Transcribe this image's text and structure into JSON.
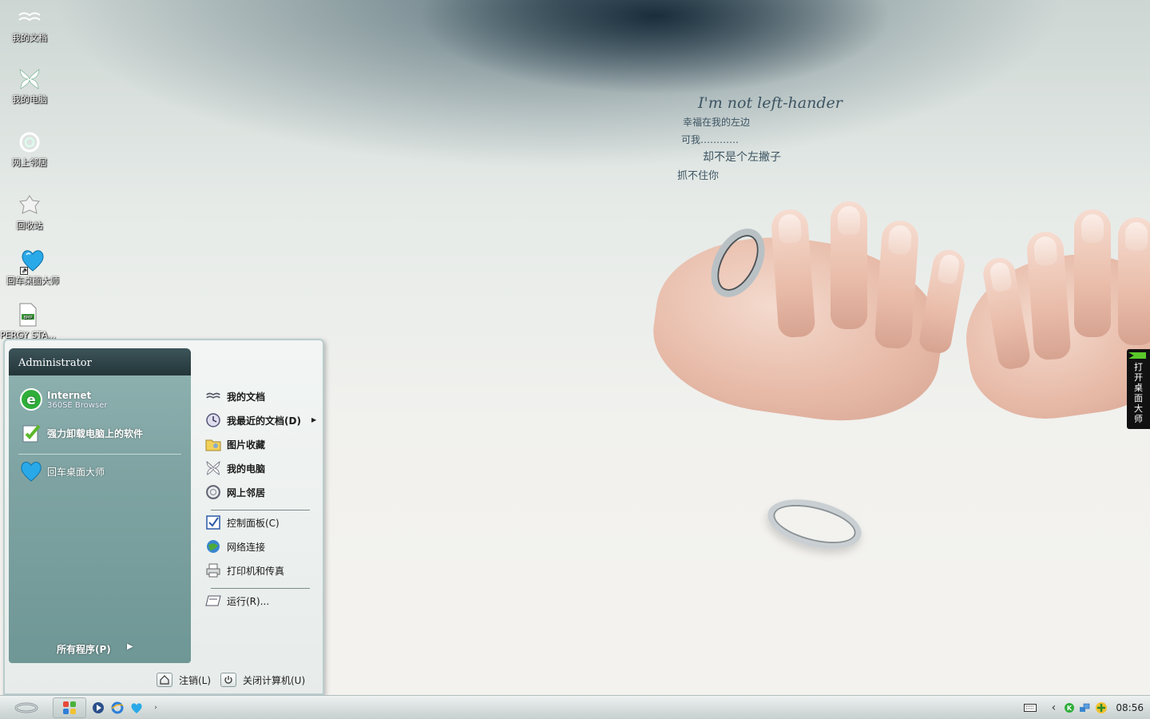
{
  "desktop": {
    "icons": [
      {
        "label": "我的文档",
        "icon": "my-documents-icon"
      },
      {
        "label": "我的电脑",
        "icon": "my-computer-icon"
      },
      {
        "label": "网上邻居",
        "icon": "network-places-icon"
      },
      {
        "label": "回收站",
        "icon": "recycle-bin-icon"
      },
      {
        "label": "回车桌面大师",
        "icon": "heart-shortcut-icon"
      },
      {
        "label": "PERGY STA...",
        "icon": "bmp-file-icon"
      }
    ]
  },
  "wallpaper": {
    "lines": [
      "I'm not left-hander",
      "幸福在我的左边",
      "可我…………",
      "却不是个左撇子",
      "抓不住你"
    ]
  },
  "start_menu": {
    "user": "Administrator",
    "pinned": [
      {
        "title": "Internet",
        "subtitle": "360SE Browser",
        "icon": "360se-browser-icon"
      },
      {
        "title": "强力卸载电脑上的软件",
        "icon": "uninstall-software-icon"
      }
    ],
    "recent": [
      {
        "title": "回车桌面大师",
        "icon": "heart-icon"
      }
    ],
    "all_programs": "所有程序(P)",
    "right_items": [
      {
        "label": "我的文档",
        "bold": true,
        "icon": "my-documents-icon"
      },
      {
        "label": "我最近的文档(D)",
        "bold": true,
        "icon": "recent-documents-icon",
        "submenu": true
      },
      {
        "label": "图片收藏",
        "bold": true,
        "icon": "my-pictures-icon"
      },
      {
        "label": "我的电脑",
        "bold": true,
        "icon": "my-computer-icon"
      },
      {
        "label": "网上邻居",
        "bold": true,
        "icon": "network-places-icon"
      },
      {
        "label": "控制面板(C)",
        "bold": false,
        "icon": "control-panel-icon"
      },
      {
        "label": "网络连接",
        "bold": false,
        "icon": "network-connections-icon"
      },
      {
        "label": "打印机和传真",
        "bold": false,
        "icon": "printer-icon"
      },
      {
        "label": "运行(R)...",
        "bold": false,
        "icon": "run-icon"
      }
    ],
    "footer": {
      "logoff": "注销(L)",
      "shutdown": "关闭计算机(U)"
    }
  },
  "side_widget": {
    "label": "打开桌面大师"
  },
  "taskbar": {
    "clock": "08:56",
    "quick_launch": [
      "media-player-icon",
      "ie-icon",
      "heart-icon"
    ],
    "tray": [
      "keyboard-icon",
      "chevron-left-icon",
      "security-k-icon",
      "network-icon",
      "green-plus-icon"
    ]
  }
}
